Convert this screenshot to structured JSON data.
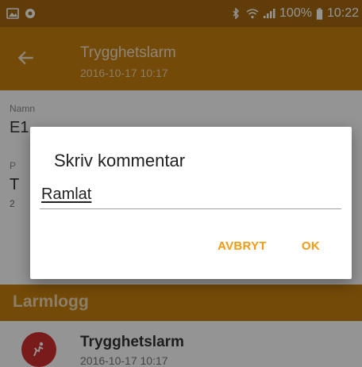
{
  "status_bar": {
    "battery": "100%",
    "time": "10:22",
    "icons": [
      "image-icon",
      "whatsapp-icon",
      "bluetooth-icon",
      "wifi-icon",
      "signal-icon",
      "battery-icon"
    ]
  },
  "app_bar": {
    "title": "Trygghetslarm",
    "subtitle": "2016-10-17 10:17"
  },
  "details": {
    "name_label": "Namn",
    "name_value": "E1",
    "frag_label": "P",
    "frag_value": "T",
    "frag_sub": "2"
  },
  "section": {
    "title": "Larmlogg"
  },
  "log": {
    "items": [
      {
        "title": "Trygghetslarm",
        "time": "2016-10-17 10:17",
        "icon": "fall-alarm-icon"
      }
    ]
  },
  "dialog": {
    "title": "Skriv kommentar",
    "input_value": "Ramlat",
    "cancel_label": "AVBRYT",
    "ok_label": "OK"
  },
  "colors": {
    "status_bar": "#a66a0e",
    "app_bar": "#c7800f",
    "accent": "#f39c12",
    "log_avatar": "#d32f2f"
  }
}
